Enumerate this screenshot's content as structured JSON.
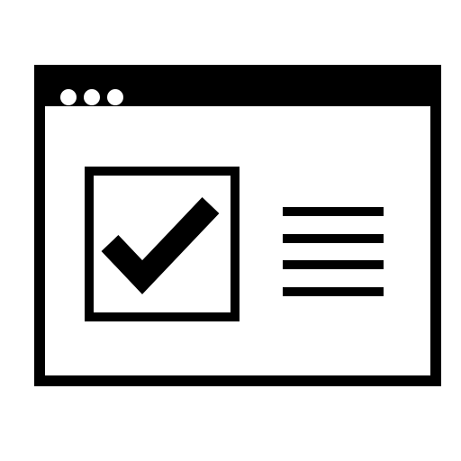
{
  "icon": {
    "name": "browser-window-checklist-icon",
    "stroke_color": "#000000",
    "background_color": "#ffffff",
    "window_controls": [
      "window-dot-icon",
      "window-dot-icon",
      "window-dot-icon"
    ],
    "content_line_count": 4
  }
}
